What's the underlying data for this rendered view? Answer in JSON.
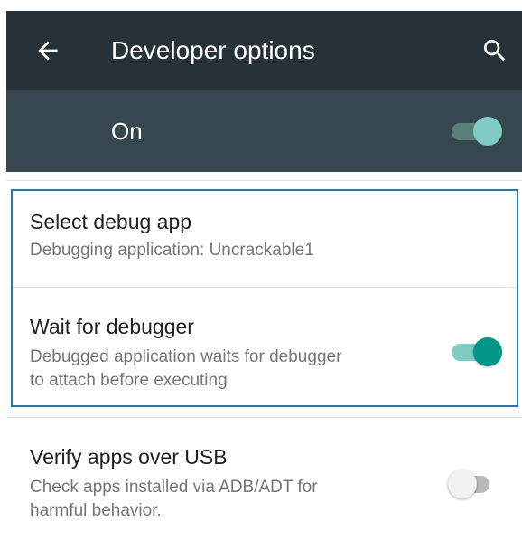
{
  "toolbar": {
    "title": "Developer options",
    "back_icon": "arrow-back-icon",
    "search_icon": "search-icon",
    "background": "#263238"
  },
  "master_switch": {
    "label": "On",
    "state": "on",
    "background": "#37474f"
  },
  "preferences": [
    {
      "title": "Select debug app",
      "summary": "Debugging application: Uncrackable1"
    },
    {
      "title": "Wait for debugger",
      "summary_line1": "Debugged application waits for debugger",
      "summary_line2": "to attach before executing",
      "switch_state": "on"
    },
    {
      "title": "Verify apps over USB",
      "summary_line1": "Check apps installed via ADB/ADT for",
      "summary_line2": "harmful behavior.",
      "switch_state": "off"
    }
  ],
  "colors": {
    "accent": "#009688",
    "highlight_border": "#1f7ab8"
  }
}
